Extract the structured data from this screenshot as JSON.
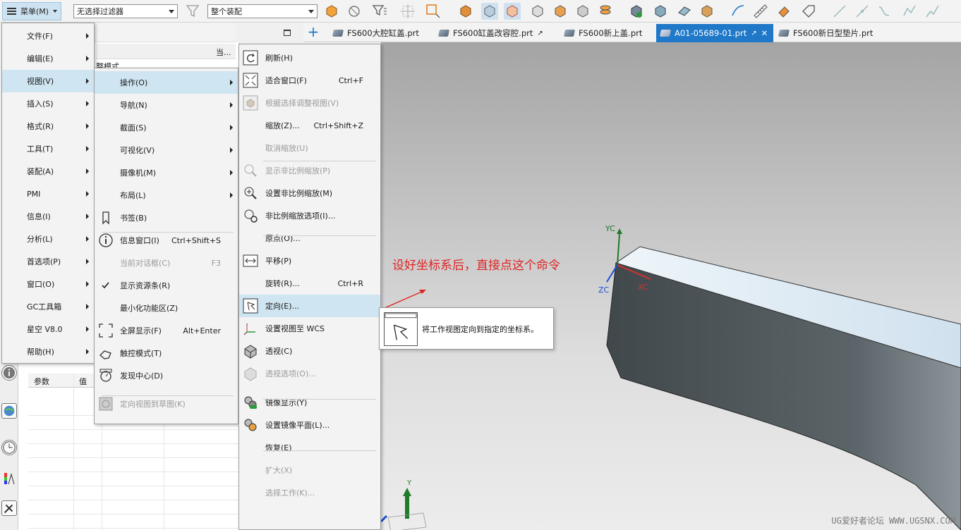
{
  "toolbar": {
    "menu_label": "菜单(M)",
    "filter_combo": "无选择过滤器",
    "scope_combo": "整个装配"
  },
  "tabs": [
    {
      "label": "FS600大腔缸盖.prt",
      "active": false
    },
    {
      "label": "FS600缸盖改容腔.prt",
      "active": false
    },
    {
      "label": "FS600新上盖.prt",
      "active": false
    },
    {
      "label": "A01-05689-01.prt",
      "active": true
    },
    {
      "label": "FS600新日型垫片.prt",
      "active": false
    }
  ],
  "navigator": {
    "col_header": "当...",
    "tree_text": "整模式",
    "params_headers": [
      "参数",
      "值"
    ]
  },
  "main_menu": [
    {
      "label": "文件(F)"
    },
    {
      "label": "编辑(E)"
    },
    {
      "label": "视图(V)",
      "active": true
    },
    {
      "label": "插入(S)"
    },
    {
      "label": "格式(R)"
    },
    {
      "label": "工具(T)"
    },
    {
      "label": "装配(A)"
    },
    {
      "label": "PMI"
    },
    {
      "label": "信息(I)"
    },
    {
      "label": "分析(L)"
    },
    {
      "label": "首选项(P)"
    },
    {
      "label": "窗口(O)"
    },
    {
      "label": "GC工具箱"
    },
    {
      "label": "星空 V8.0"
    },
    {
      "label": "帮助(H)"
    }
  ],
  "view_menu": [
    {
      "label": "操作(O)",
      "sub": true,
      "active": true
    },
    {
      "label": "导航(N)",
      "sub": true
    },
    {
      "label": "截面(S)",
      "sub": true
    },
    {
      "label": "可视化(V)",
      "sub": true
    },
    {
      "label": "摄像机(M)",
      "sub": true
    },
    {
      "label": "布局(L)",
      "sub": true
    },
    {
      "label": "书签(B)",
      "icon": "bookmark-icon"
    },
    {
      "label": "信息窗口(I)",
      "shortcut": "Ctrl+Shift+S",
      "icon": "info-icon"
    },
    {
      "label": "当前对话框(C)",
      "shortcut": "F3",
      "disabled": true
    },
    {
      "label": "显示资源条(R)",
      "icon": "checkmark-icon"
    },
    {
      "label": "最小化功能区(Z)"
    },
    {
      "label": "全屏显示(F)",
      "shortcut": "Alt+Enter",
      "icon": "fullscreen-icon"
    },
    {
      "label": "触控模式(T)",
      "icon": "touch-icon"
    },
    {
      "label": "发现中心(D)",
      "icon": "discovery-icon"
    },
    {
      "label": "定向视图到草图(K)",
      "disabled": true,
      "icon": "sketch-orient-icon"
    }
  ],
  "operation_menu": [
    {
      "label": "刷新(H)",
      "icon": "refresh-icon"
    },
    {
      "label": "适合窗口(F)",
      "shortcut": "Ctrl+F",
      "icon": "fit-icon"
    },
    {
      "label": "根据选择调整视图(V)",
      "disabled": true,
      "icon": "fit-selection-icon"
    },
    {
      "label": "缩放(Z)...",
      "shortcut": "Ctrl+Shift+Z"
    },
    {
      "label": "取消缩放(U)",
      "disabled": true
    },
    {
      "label": "显示非比例缩放(P)",
      "disabled": true,
      "icon": "nonuniform-show-icon"
    },
    {
      "label": "设置非比例缩放(M)",
      "icon": "nonuniform-set-icon"
    },
    {
      "label": "非比例缩放选项(I)...",
      "icon": "nonuniform-options-icon"
    },
    {
      "label": "原点(O)..."
    },
    {
      "label": "平移(P)",
      "icon": "pan-icon"
    },
    {
      "label": "旋转(R)...",
      "shortcut": "Ctrl+R"
    },
    {
      "label": "定向(E)...",
      "active": true,
      "icon": "orient-icon"
    },
    {
      "label": "设置视图至 WCS",
      "icon": "wcs-icon"
    },
    {
      "label": "透视(C)",
      "icon": "perspective-icon"
    },
    {
      "label": "透视选项(O)...",
      "disabled": true,
      "icon": "perspective-options-icon"
    },
    {
      "label": "镜像显示(Y)",
      "icon": "mirror-display-icon"
    },
    {
      "label": "设置镜像平面(L)...",
      "icon": "mirror-plane-icon"
    },
    {
      "label": "恢复(E)"
    },
    {
      "label": "扩大(X)",
      "disabled": true
    },
    {
      "label": "选择工作(K)...",
      "disabled": true
    }
  ],
  "tooltip": {
    "text": "将工作视图定向到指定的坐标系。"
  },
  "viewport": {
    "annotation": "设好坐标系后，直接点这个命令",
    "axis_yc": "YC",
    "axis_xc": "XC",
    "axis_zc": "ZC",
    "axis_y": "Y",
    "watermark": "UG爱好者论坛 WWW.UGSNX.COM"
  },
  "colors": {
    "menu_highlight": "#cfe5f1",
    "active_tab": "#1f78c8",
    "annotation_red": "#e02424",
    "axis_green": "#1f7a2a",
    "axis_red": "#d63030",
    "axis_blue": "#1d4fd6"
  }
}
